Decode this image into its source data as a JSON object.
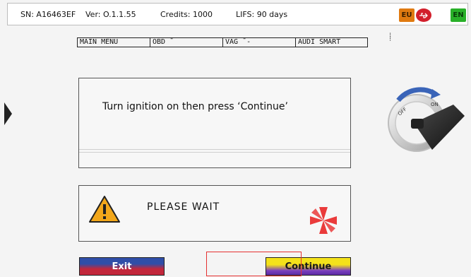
{
  "status_bar": {
    "serial": "SN: A16463EF",
    "version": "Ver: O.1.1.55",
    "credits": "Credits: 1000",
    "lifs": "LIFS: 90 days",
    "flags": [
      {
        "label": "EU",
        "icon": "eu-flag-icon",
        "color": "#e07a10"
      },
      {
        "label": "",
        "icon": "usb-icon",
        "color": "#d21f2c"
      },
      {
        "label": "EN",
        "icon": "en-language-icon",
        "color": "#28b028"
      }
    ]
  },
  "breadcrumb": [
    "MAIN MENU",
    "OBD ̄",
    "VAG ̄  -",
    "AUDI SMART"
  ],
  "message": {
    "text": "Turn ignition on then press ‘Continue’"
  },
  "wait": {
    "text": "PLEASE WAIT",
    "icon": "warning-icon",
    "spinner": "spinner-icon"
  },
  "illustration": {
    "icon": "ignition-key-icon",
    "labels": [
      "OFF",
      "ON"
    ]
  },
  "buttons": {
    "exit": "Exit",
    "continue": "Continue"
  },
  "colors": {
    "exit_top": "#2f4ea8",
    "exit_bottom": "#c2273b",
    "continue_top": "#f4e21a",
    "continue_bottom": "#5b2aa3",
    "highlight": "#e53030"
  }
}
